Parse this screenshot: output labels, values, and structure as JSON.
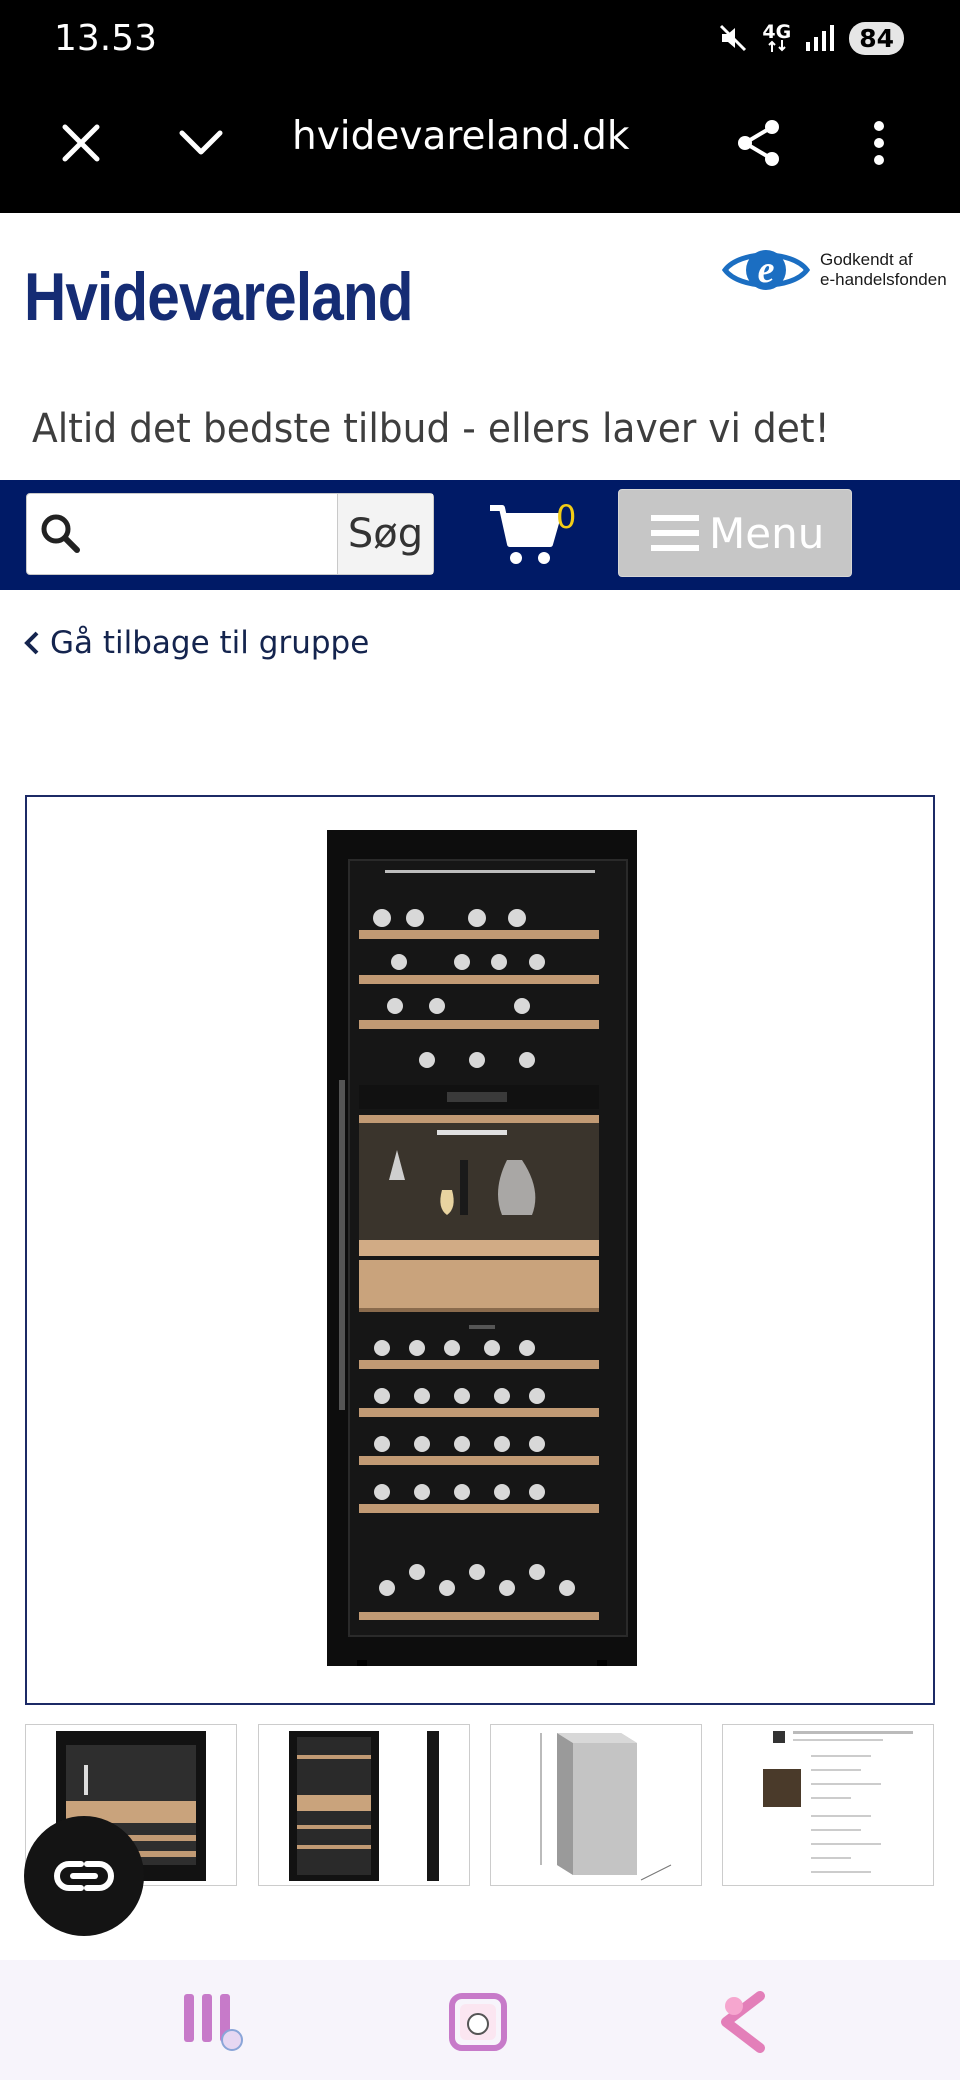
{
  "status_bar": {
    "time": "13.53",
    "network": "4G",
    "battery": "84"
  },
  "browser": {
    "url_text": "hvidevareland.dk",
    "icons": [
      "close-icon",
      "chevron-down-icon",
      "share-icon",
      "more-vert-icon"
    ]
  },
  "header": {
    "logo": "Hvidevareland",
    "badge_line1": "Godkendt af",
    "badge_line2": "e-handelsfonden",
    "tagline": "Altid det bedste tilbud - ellers laver vi det!"
  },
  "nav": {
    "search_placeholder": "",
    "search_button": "Søg",
    "cart_count": "0",
    "menu_label": "Menu"
  },
  "back_link": "Gå tilbage til gruppe",
  "product": {
    "thumbnails": [
      "thumb-fridge-open",
      "thumb-fridge-front-side",
      "thumb-dimension-drawing",
      "thumb-spec-sheet"
    ]
  },
  "colors": {
    "brand_blue": "#152c74",
    "nav_blue": "#001a66",
    "cart_count": "#f2cc16",
    "menu_gray": "#c6c6c6"
  }
}
